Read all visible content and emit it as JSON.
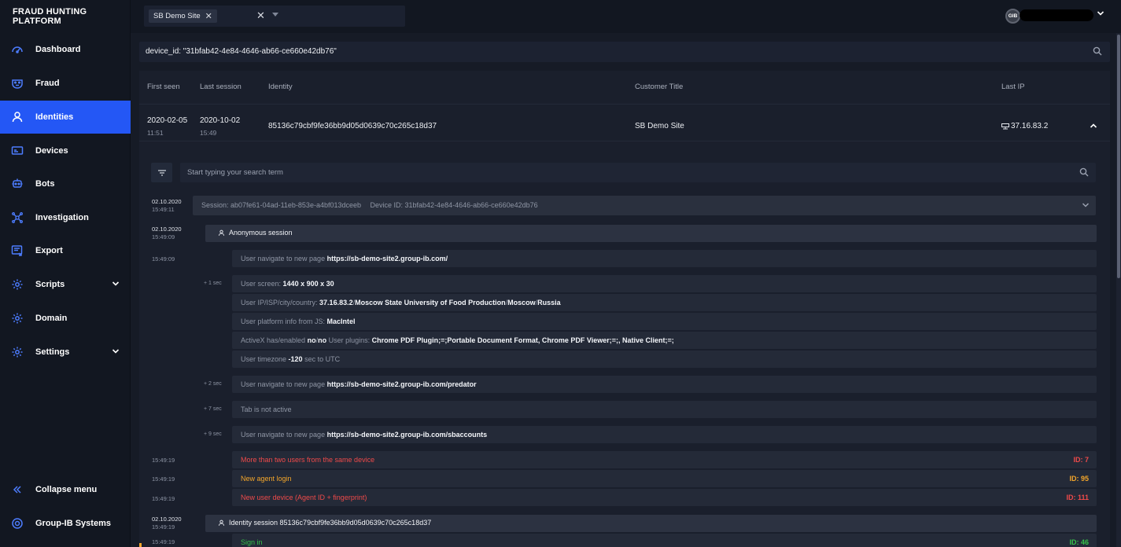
{
  "app": {
    "brand": "FRAUD HUNTING PLATFORM"
  },
  "sidebar": {
    "items": [
      {
        "label": "Dashboard",
        "icon": "dashboard-icon"
      },
      {
        "label": "Fraud",
        "icon": "fraud-mask-icon"
      },
      {
        "label": "Identities",
        "icon": "user-icon",
        "active": true
      },
      {
        "label": "Devices",
        "icon": "device-icon"
      },
      {
        "label": "Bots",
        "icon": "bot-icon"
      },
      {
        "label": "Investigation",
        "icon": "network-icon"
      },
      {
        "label": "Export",
        "icon": "export-icon"
      },
      {
        "label": "Scripts",
        "icon": "gear-icon",
        "expandable": true
      },
      {
        "label": "Domain",
        "icon": "gear-icon"
      },
      {
        "label": "Settings",
        "icon": "gear-icon",
        "expandable": true
      }
    ],
    "collapse_label": "Collapse menu",
    "company_label": "Group-IB Systems"
  },
  "topbar": {
    "site_chip": "SB Demo Site",
    "avatar_text": "GIB"
  },
  "query": {
    "text": "device_id: \"31bfab42-4e84-4646-ab66-ce660e42db76\""
  },
  "table": {
    "headers": {
      "first_seen": "First seen",
      "last_session": "Last session",
      "identity": "Identity",
      "customer_title": "Customer Title",
      "last_ip": "Last IP"
    },
    "row": {
      "first_seen_date": "2020-02-05",
      "first_seen_time": "11:51",
      "last_session_date": "2020-10-02",
      "last_session_time": "15:49",
      "identity": "85136c79cbf9fe36bb9d05d0639c70c265c18d37",
      "customer_title": "SB Demo Site",
      "last_ip": "37.16.83.2"
    }
  },
  "detail": {
    "search_placeholder": "Start typing your search term",
    "session": {
      "date": "02.10.2020",
      "time": "15:49:11",
      "session_label": "Session: ab07fe61-04ad-11eb-853e-a4bf013dceeb",
      "device_label": "Device ID: 31bfab42-4e84-4646-ab66-ce660e42db76"
    },
    "anon": {
      "date": "02.10.2020",
      "time": "15:49:09",
      "label": "Anonymous session"
    },
    "events": {
      "e1_time": "15:49:09",
      "e1_label": "User navigate to new page",
      "e1_val": "https://sb-demo-site2.group-ib.com/",
      "o1": "+ 1 sec",
      "screen_label": "User screen:",
      "screen_val": "1440 x 900 x 30",
      "ip_label": "User IP/ISP/city/country:",
      "ip_v1": "37.16.83.2",
      "ip_v2": "Moscow State University of Food Production",
      "ip_v3": "Moscow",
      "ip_v4": "Russia",
      "platform_label": "User platform info from JS:",
      "platform_val": "MacIntel",
      "activex_label": "ActiveX has/enabled",
      "activex_v1": "no",
      "activex_v2": "no",
      "plugins_label": "User plugins:",
      "plugins_val": "Chrome PDF Plugin;=;Portable Document Format, Chrome PDF Viewer;=;, Native Client;=;",
      "tz_label": "User timezone",
      "tz_val": "-120",
      "tz_suffix": "sec to UTC",
      "o2": "+ 2 sec",
      "e2_label": "User navigate to new page",
      "e2_val": "https://sb-demo-site2.group-ib.com/predator",
      "o3": "+ 7 sec",
      "e3_label": "Tab is not active",
      "o4": "+ 9 sec",
      "e4_label": "User navigate to new page",
      "e4_val": "https://sb-demo-site2.group-ib.com/sbaccounts"
    },
    "alerts": [
      {
        "time": "15:49:19",
        "label": "More than two users from the same device",
        "id": "ID: 7",
        "color": "#ef4a4a"
      },
      {
        "time": "15:49:19",
        "label": "New agent login",
        "id": "ID: 95",
        "color": "#f4a62a"
      },
      {
        "time": "15:49:19",
        "label": "New user device (Agent ID + fingerprint)",
        "id": "ID: 111",
        "color": "#ef4a4a"
      }
    ],
    "identity_session": {
      "date": "02.10.2020",
      "time": "15:49:19",
      "label": "Identity session 85136c79cbf9fe36bb9d05d0639c70c265c18d37"
    },
    "signin": {
      "time": "15:49:19",
      "label": "Sign in",
      "id": "ID: 46",
      "color": "#36c24a"
    }
  },
  "colors": {
    "accent": "#2457f5",
    "background": "#161b26",
    "sidebar": "#121721"
  }
}
